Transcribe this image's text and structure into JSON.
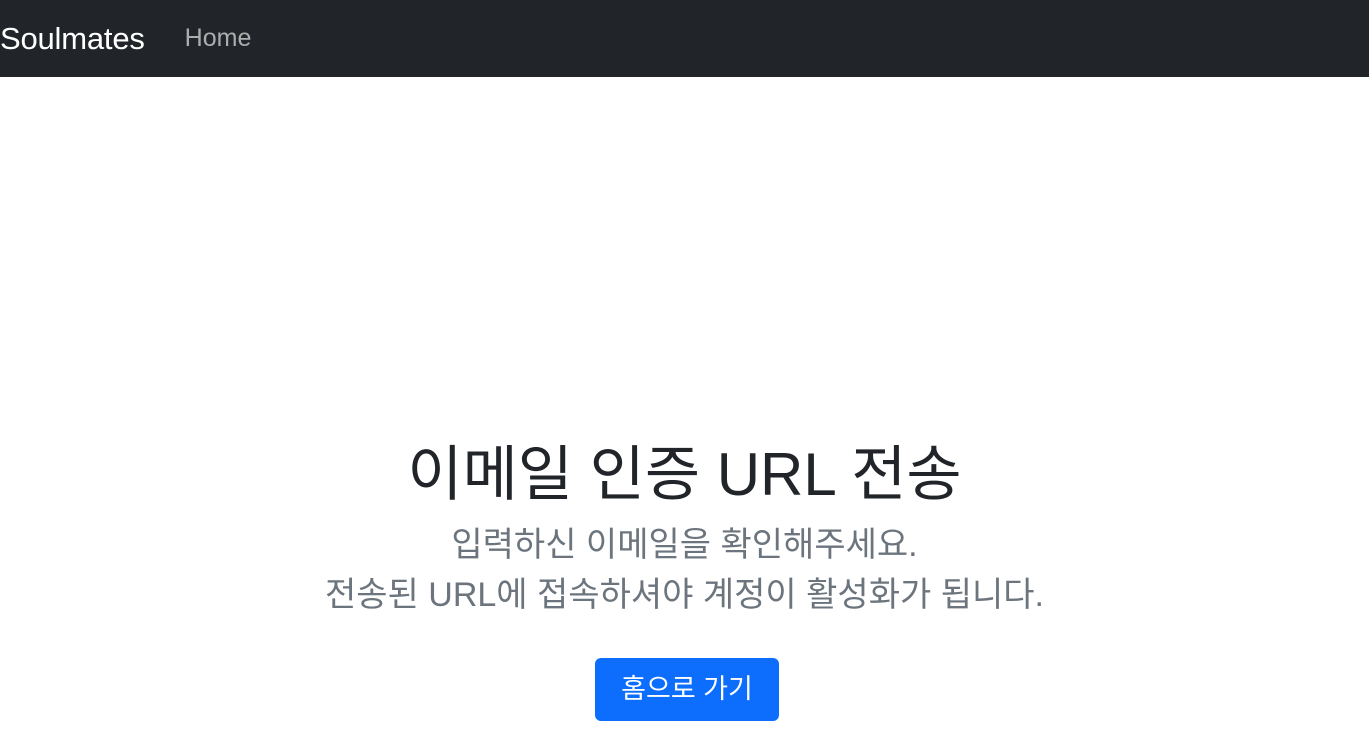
{
  "navbar": {
    "brand": "Soulmates",
    "links": [
      {
        "label": "Home"
      }
    ],
    "background": "#212529"
  },
  "main": {
    "title": "이메일 인증 URL 전송",
    "lead_line_1": "입력하신 이메일을 확인해주세요.",
    "lead_line_2": "전송된 URL에 접속하셔야 계정이 활성화가 됩니다.",
    "button_label": "홈으로 가기",
    "button_color": "#0d6efd"
  }
}
